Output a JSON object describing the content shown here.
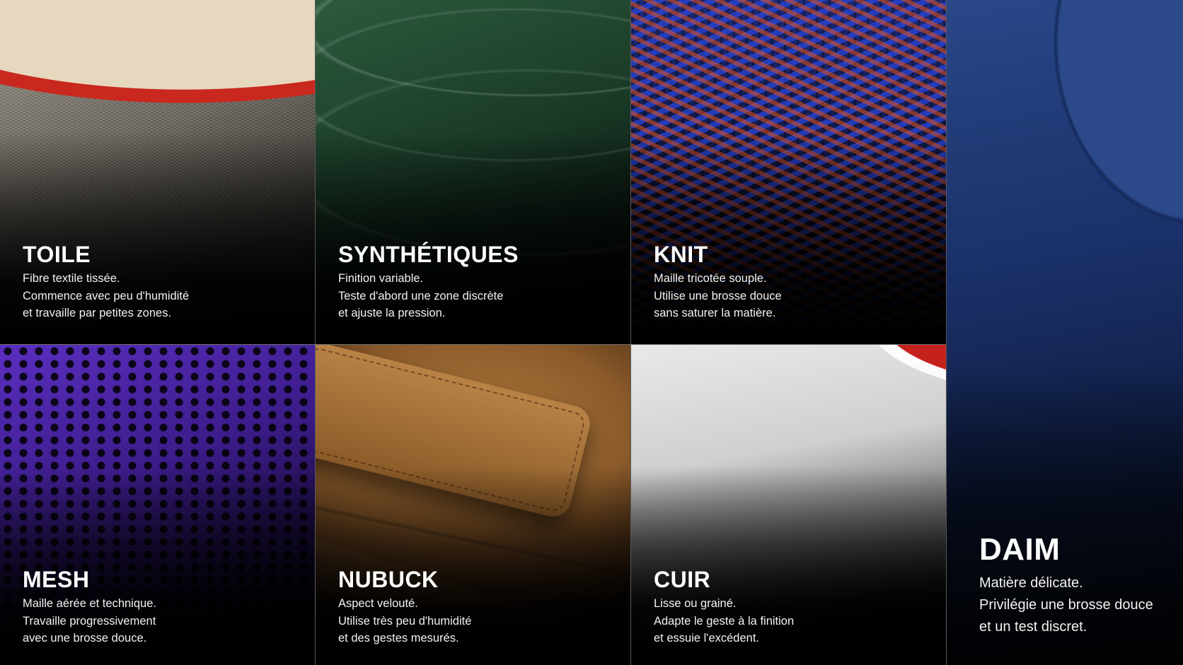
{
  "materials": {
    "toile": {
      "title": "TOILE",
      "lines": [
        "Fibre textile tissée.",
        "Commence avec peu d'humidité",
        "et travaille par petites zones."
      ]
    },
    "synthetiques": {
      "title": "SYNTHÉTIQUES",
      "lines": [
        "Finition variable.",
        "Teste d'abord une zone discrète",
        "et ajuste la pression."
      ]
    },
    "knit": {
      "title": "KNIT",
      "lines": [
        "Maille tricotée souple.",
        "Utilise une brosse douce",
        "sans saturer la matière."
      ]
    },
    "mesh": {
      "title": "MESH",
      "lines": [
        "Maille aérée et technique.",
        "Travaille progressivement",
        "avec une brosse douce."
      ]
    },
    "nubuck": {
      "title": "NUBUCK",
      "lines": [
        "Aspect velouté.",
        "Utilise très peu d'humidité",
        "et des gestes mesurés."
      ]
    },
    "cuir": {
      "title": "CUIR",
      "lines": [
        "Lisse ou grainé.",
        "Adapte le geste à la finition",
        "et essuie l'excédent."
      ]
    },
    "daim": {
      "title": "DAIM",
      "lines": [
        "Matière délicate.",
        "Privilégie une brosse douce",
        "et un test discret."
      ]
    }
  },
  "colors": {
    "toile_trim": "#c9281f",
    "synthetiques": "#1a3a27",
    "knit_blue": "#2846dc",
    "knit_orange": "#e65014",
    "mesh": "#5a2ec0",
    "nubuck": "#8a5a2a",
    "cuir_trim": "#c4211c",
    "daim": "#1a3068"
  }
}
